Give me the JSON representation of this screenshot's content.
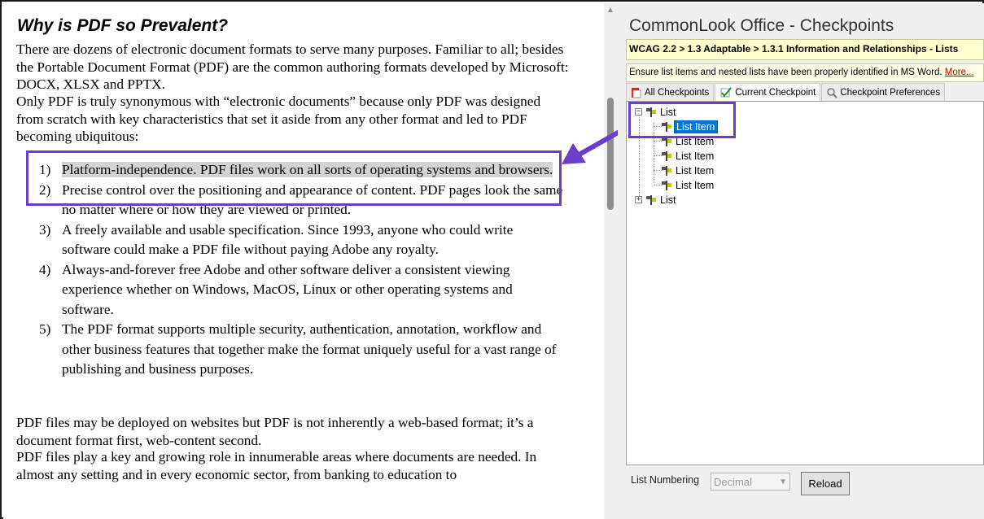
{
  "document": {
    "title": "Why is PDF so Prevalent?",
    "paragraphs": [
      "There are dozens of electronic document formats to serve many purposes. Familiar to all; besides the Portable Document Format (PDF) are the common authoring formats developed by Microsoft: DOCX, XLSX and PPTX.",
      "Only PDF is truly synonymous with “electronic documents” because only PDF was designed from scratch with key characteristics that set it aside from any other format and led to PDF becoming ubiquitous:",
      "PDF files may be deployed on websites but PDF is not inherently a web-based format; it’s a document format first, web-content second.",
      "PDF files play a key and growing role in innumerable areas where documents are needed. In almost any setting and in every economic sector, from banking to education to"
    ],
    "list": [
      {
        "num": "1)",
        "text": "Platform-independence. PDF files work on all sorts of operating systems and browsers."
      },
      {
        "num": "2)",
        "text": "Precise control over the positioning and appearance of content. PDF pages look the same no matter where or how they are viewed or printed."
      },
      {
        "num": "3)",
        "text": "A freely available and usable specification. Since 1993, anyone who could write software could make a PDF file without paying Adobe any royalty."
      },
      {
        "num": "4)",
        "text": "Always-and-forever free Adobe and other software deliver a consistent viewing experience whether on Windows, MacOS, Linux or other operating systems and software."
      },
      {
        "num": "5)",
        "text": "The PDF format supports multiple security, authentication, annotation, workflow and other business features that together make the format uniquely useful for a vast range of publishing and business purposes."
      }
    ]
  },
  "pane": {
    "title": "CommonLook Office - Checkpoints",
    "breadcrumb": "WCAG 2.2 > 1.3 Adaptable > 1.3.1 Information and Relationships - Lists",
    "hint": "Ensure list items and nested lists have been properly identified in MS Word. ",
    "hint_link": "More...",
    "tabs": [
      "All Checkpoints",
      "Current Checkpoint",
      "Checkpoint Preferences"
    ],
    "tree": {
      "root": "List",
      "children": [
        "List Item",
        "List Item",
        "List Item",
        "List Item",
        "List Item"
      ],
      "second": "List",
      "expand_open": "−",
      "expand_closed": "+"
    },
    "numbering_label": "List Numbering",
    "numbering_value": "Decimal",
    "reload": "Reload"
  },
  "colors": {
    "highlight_box": "#6a3ec8",
    "selection": "#0078d7",
    "breadcrumb_bg": "#ffffcc"
  }
}
